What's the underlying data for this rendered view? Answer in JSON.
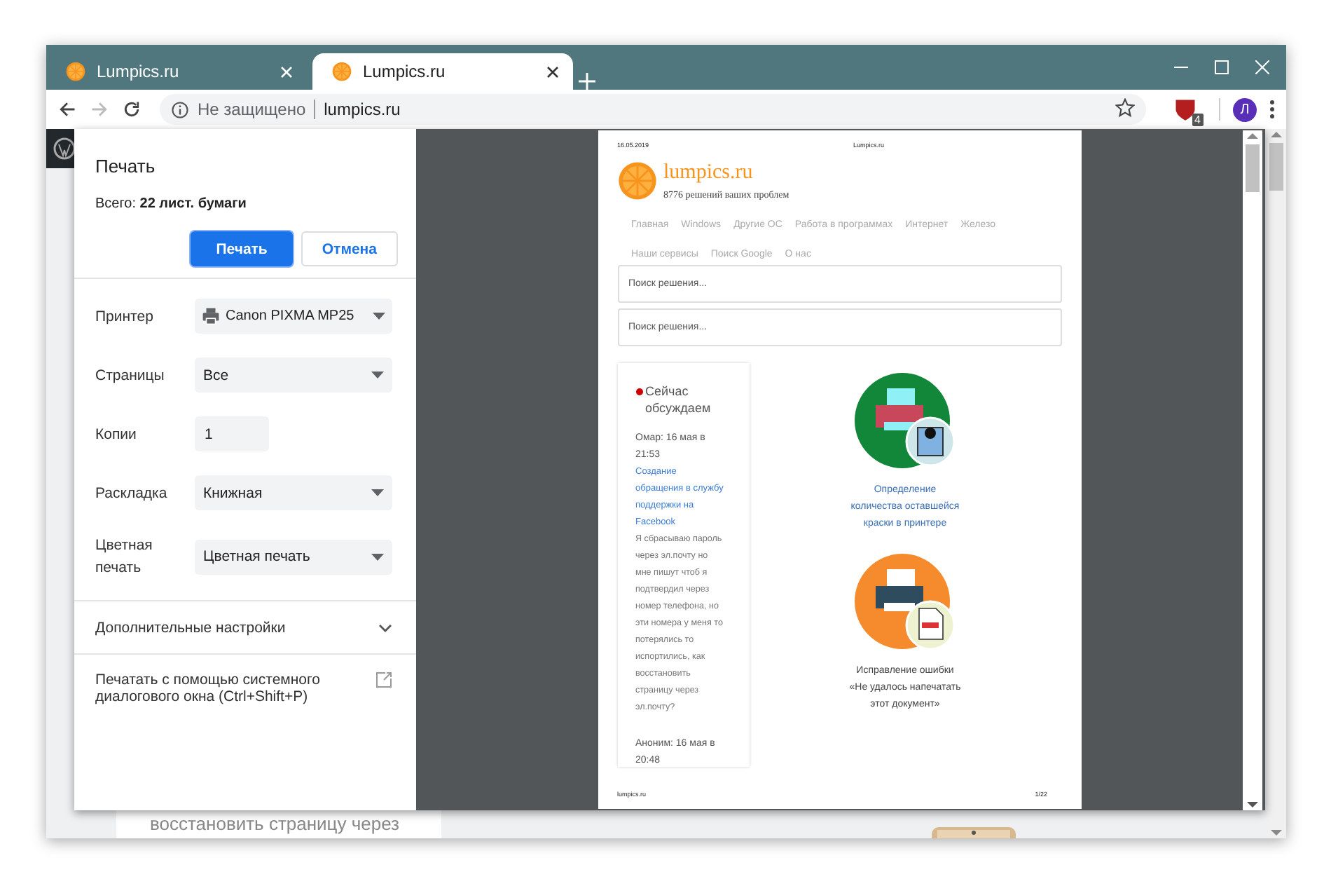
{
  "tabs": [
    {
      "title": "Lumpics.ru",
      "selected": false
    },
    {
      "title": "Lumpics.ru",
      "selected": true
    }
  ],
  "address_bar": {
    "security": "Не защищено",
    "url": "lumpics.ru"
  },
  "extension_badge": "4",
  "profile_initial": "Л",
  "background_page": {
    "text": "восстановить страницу через"
  },
  "print_dialog": {
    "title": "Печать",
    "total": "Всего: **22 лист. бумаги**",
    "buttons": [
      {
        "label": "Печать",
        "kind": "primary"
      },
      {
        "label": "Отмена",
        "kind": "secondary"
      }
    ],
    "settings": [
      {
        "label": "Принтер",
        "kind": "printer",
        "value": "Canon PIXMA MP25"
      },
      {
        "label": "Страницы",
        "kind": "select",
        "value": "Все"
      },
      {
        "label": "Копии",
        "kind": "input",
        "value": "1"
      },
      {
        "label": "Раскладка",
        "kind": "select",
        "value": "Книжная"
      },
      {
        "label": "Цветная печать",
        "kind": "select",
        "value": "Цветная печать"
      }
    ],
    "more_settings": {
      "label": "Дополнительные настройки",
      "expanded": false
    },
    "system_dialog": "Печатать с помощью системного диалогового окна (Ctrl+Shift+P)"
  },
  "preview": {
    "header_date": "16.05.2019",
    "header_title": "Lumpics.ru",
    "site_title": "lumpics.ru",
    "tagline": "8776 решений ваших проблем",
    "nav": [
      "Главная",
      "Windows",
      "Другие ОС",
      "Работа в программах",
      "Интернет",
      "Железо",
      "Наши сервисы",
      "Поиск Google",
      "О нас"
    ],
    "search_fields": [
      {
        "placeholder": "Поиск решения..."
      },
      {
        "placeholder": "Поиск решения..."
      }
    ],
    "sidebar": {
      "heading": "Сейчас обсуждаем",
      "comments": [
        {
          "meta": "Омар: 16 мая в 21:53",
          "link": "Создание обращения в службу поддержки на Facebook",
          "text": "Я сбрасываю пароль через эл.почту но мне пишут чтоб я подтвердил через номер телефона, но эти номера у меня то потерялись то испортились, как восстановить страницу через эл.почту?"
        },
        {
          "meta": "Аноним: 16 мая в 20:48"
        }
      ]
    },
    "articles": [
      {
        "title": "Определение количества оставшейся краски в принтере",
        "kind": "ink",
        "color": "#12873a"
      },
      {
        "title": "Исправление ошибки «Не удалось напечатать этот документ»",
        "kind": "error",
        "color": "#f58b2c"
      }
    ],
    "footer_left": "lumpics.ru",
    "footer_right": "1/22"
  }
}
